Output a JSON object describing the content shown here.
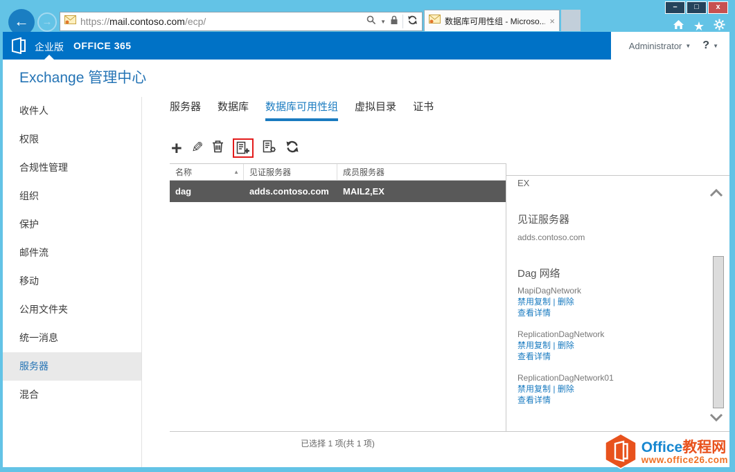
{
  "browser": {
    "url": {
      "scheme": "https://",
      "host": "mail.contoso.com",
      "path": "/ecp/"
    },
    "tab": {
      "title": "数据库可用性组 - Microso..."
    },
    "window_buttons": {
      "minimize": "–",
      "maximize": "□",
      "close": "x"
    }
  },
  "icons": {
    "back": "←",
    "forward": "→",
    "dropdown": "▼",
    "sort_asc": "▲",
    "star": "★",
    "tab_close": "×",
    "plus": "+",
    "pencil": "✎",
    "help": "?"
  },
  "topbar": {
    "edition": "企业版",
    "brand": "OFFICE 365",
    "user": "Administrator"
  },
  "page": {
    "title": "Exchange 管理中心"
  },
  "sidebar": {
    "items": [
      {
        "label": "收件人"
      },
      {
        "label": "权限"
      },
      {
        "label": "合规性管理"
      },
      {
        "label": "组织"
      },
      {
        "label": "保护"
      },
      {
        "label": "邮件流"
      },
      {
        "label": "移动"
      },
      {
        "label": "公用文件夹"
      },
      {
        "label": "统一消息"
      },
      {
        "label": "服务器",
        "selected": true
      },
      {
        "label": "混合"
      }
    ]
  },
  "tabs": {
    "items": [
      {
        "label": "服务器"
      },
      {
        "label": "数据库"
      },
      {
        "label": "数据库可用性组",
        "selected": true
      },
      {
        "label": "虚拟目录"
      },
      {
        "label": "证书"
      }
    ]
  },
  "table": {
    "columns": [
      "名称",
      "见证服务器",
      "成员服务器"
    ],
    "rows": [
      {
        "name": "dag",
        "witness": "adds.contoso.com",
        "members": "MAIL2,EX"
      }
    ]
  },
  "details": {
    "overflow_text": "EX",
    "witness_heading": "见证服务器",
    "witness_value": "adds.contoso.com",
    "dag_heading": "Dag 网络",
    "action_separator": "|",
    "networks": [
      {
        "name": "MapiDagNetwork",
        "disable": "禁用复制",
        "remove": "删除",
        "view": "查看详情"
      },
      {
        "name": "ReplicationDagNetwork",
        "disable": "禁用复制",
        "remove": "删除",
        "view": "查看详情"
      },
      {
        "name": "ReplicationDagNetwork01",
        "disable": "禁用复制",
        "remove": "删除",
        "view": "查看详情"
      }
    ]
  },
  "status": {
    "selection": "已选择 1 项(共 1 项)"
  },
  "watermark": {
    "brand_blue": "Office",
    "brand_orange": "教程网",
    "site": "www.office26.com"
  },
  "colors": {
    "accent": "#0072c6",
    "frame": "#63c3e6",
    "selected_row": "#595959",
    "link": "#1a7bc0",
    "highlight": "#e31b1b"
  }
}
